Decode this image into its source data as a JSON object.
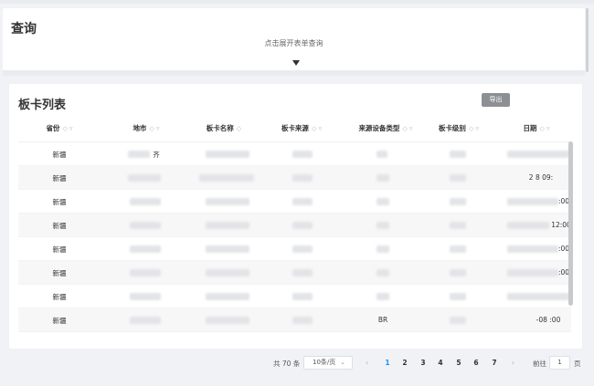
{
  "query": {
    "title": "查询",
    "hint": "点击展开表单查询"
  },
  "list": {
    "title": "板卡列表",
    "export_label": "导出",
    "columns": [
      {
        "label": "省份",
        "sort": "◇ ▿"
      },
      {
        "label": "地市",
        "sort": "◇ ▿"
      },
      {
        "label": "板卡名称",
        "sort": "◇"
      },
      {
        "label": "板卡来源",
        "sort": "◇ ▿"
      },
      {
        "label": "来源设备类型",
        "sort": "◇ ▿"
      },
      {
        "label": "板卡级别",
        "sort": "◇ ▿"
      },
      {
        "label": "日期",
        "sort": "◇ ▿"
      }
    ],
    "rows": [
      {
        "province": "新疆",
        "city_tail": "齐",
        "source_type_tail": "",
        "date_fragment": ""
      },
      {
        "province": "新疆",
        "city_tail": "",
        "source_type_tail": "",
        "date_fragment": "2 8 09:"
      },
      {
        "province": "新疆",
        "city_tail": "",
        "source_type_tail": "",
        "date_fragment": ":00"
      },
      {
        "province": "新疆",
        "city_tail": "",
        "source_type_tail": "",
        "date_fragment": "12:00"
      },
      {
        "province": "新疆",
        "city_tail": "",
        "source_type_tail": "",
        "date_fragment": ":00"
      },
      {
        "province": "新疆",
        "city_tail": "",
        "source_type_tail": "",
        "date_fragment": ":00"
      },
      {
        "province": "新疆",
        "city_tail": "",
        "source_type_tail": "",
        "date_fragment": ""
      },
      {
        "province": "新疆",
        "city_tail": "",
        "source_type_tail": "BR",
        "date_fragment": "-08 :00"
      }
    ]
  },
  "pagination": {
    "total_text": "共 70 条",
    "page_size": "10条/页",
    "prev": "‹",
    "next": "›",
    "pages": [
      "1",
      "2",
      "3",
      "4",
      "5",
      "6",
      "7"
    ],
    "active_page": "1",
    "goto_label": "前往",
    "goto_value": "1",
    "goto_suffix": "页"
  },
  "colors": {
    "accent": "#1890ff",
    "export_button": "#8c8f94",
    "background": "#f0f2f5"
  }
}
